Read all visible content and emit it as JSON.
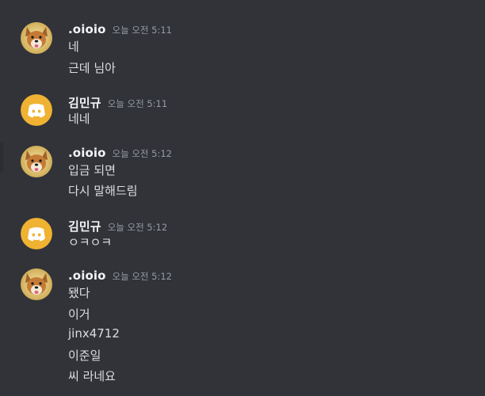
{
  "top_fragment": "",
  "groups": [
    {
      "username": ".oioio",
      "timestamp": "오늘 오전 5:11",
      "avatar": "dog-avatar-icon",
      "lines": [
        "네",
        "근데 님아"
      ]
    },
    {
      "username": "김민규",
      "timestamp": "오늘 오전 5:11",
      "avatar": "discord-logo-icon",
      "lines": [
        "네네"
      ]
    },
    {
      "username": ".oioio",
      "timestamp": "오늘 오전 5:12",
      "avatar": "dog-avatar-icon",
      "lines": [
        "입금 되면",
        "다시 말해드림"
      ]
    },
    {
      "username": "김민규",
      "timestamp": "오늘 오전 5:12",
      "avatar": "discord-logo-icon",
      "lines": [
        "ㅇㅋㅇㅋ"
      ]
    },
    {
      "username": ".oioio",
      "timestamp": "오늘 오전 5:12",
      "avatar": "dog-avatar-icon",
      "lines": [
        "됐다",
        "이거",
        "jinx4712",
        "이준일",
        "씨 라네요"
      ]
    }
  ],
  "colors": {
    "background": "#313338",
    "discord_avatar": "#f0b232",
    "username": "#f2f3f5",
    "text": "#dbdee1",
    "timestamp": "#949ba4"
  }
}
